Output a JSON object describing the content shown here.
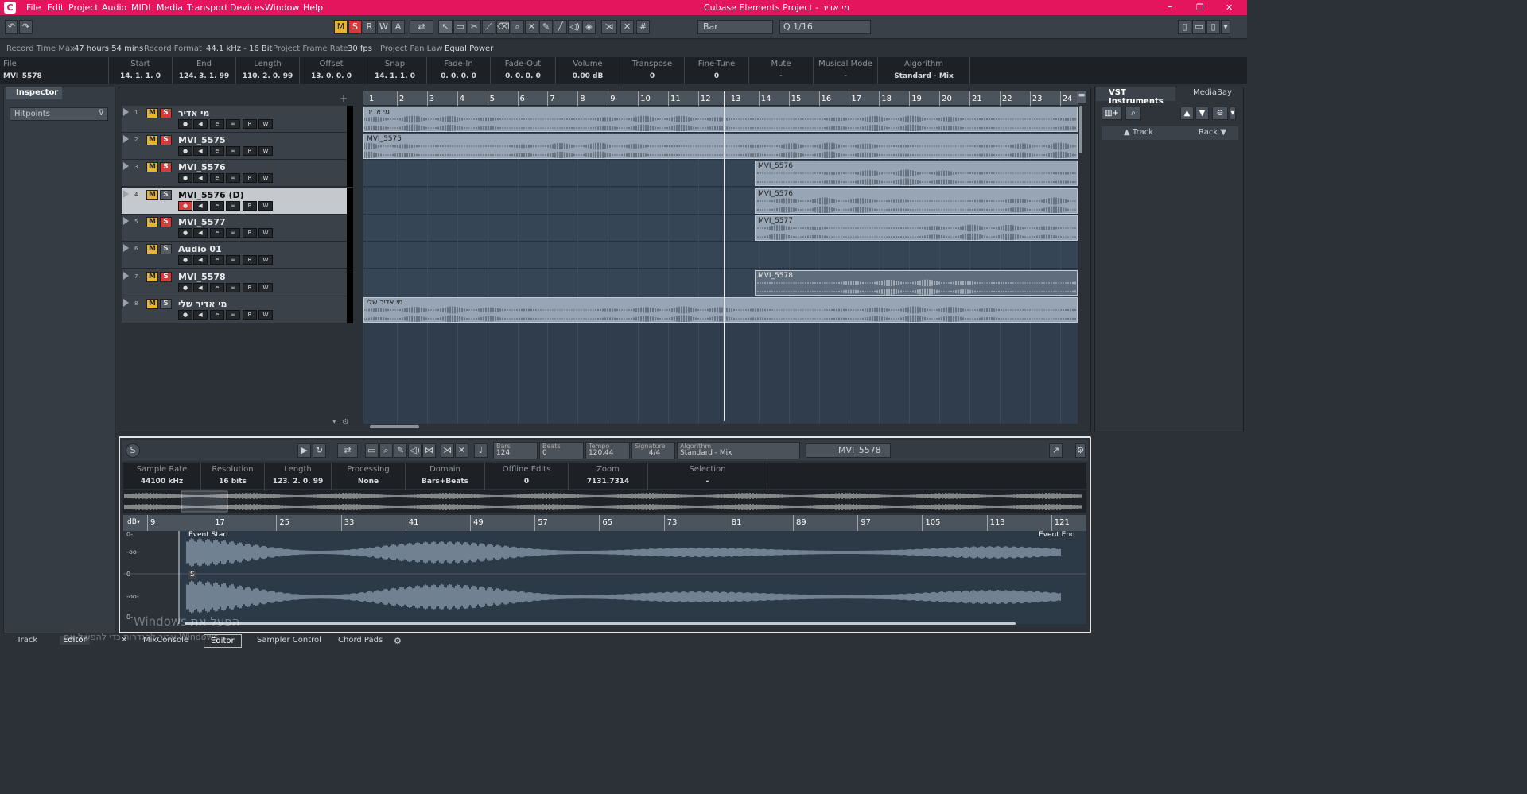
{
  "titlebar": {
    "logo": "C",
    "menus": [
      "File",
      "Edit",
      "Project",
      "Audio",
      "MIDI",
      "Media",
      "Transport",
      "Devices",
      "Window",
      "Help"
    ],
    "title": "Cubase Elements Project - מי אדיר",
    "minimize": "–",
    "restore": "❐",
    "close": "✕"
  },
  "toolbar": {
    "undo": "↶",
    "redo": "↷",
    "m": "M",
    "s": "S",
    "r": "R",
    "w": "W",
    "a": "A",
    "grid_type": "Bar",
    "quantize": "1/16",
    "quantize_prefix": "Q"
  },
  "project_info": {
    "record_time_max_label": "Record Time Max",
    "record_time_max": "47 hours 54 mins",
    "record_format_label": "Record Format",
    "record_format": "44.1 kHz - 16 Bit",
    "frame_rate_label": "Project Frame Rate",
    "frame_rate": "30 fps",
    "pan_law_label": "Project Pan Law",
    "pan_law": "Equal Power"
  },
  "infoline": {
    "file_label": "File",
    "file": "MVI_5578",
    "cols": [
      {
        "h": "Start",
        "v": "14. 1. 1.   0"
      },
      {
        "h": "End",
        "v": "124. 3. 1. 99"
      },
      {
        "h": "Length",
        "v": "110. 2. 0. 99"
      },
      {
        "h": "Offset",
        "v": "13. 0. 0.   0"
      },
      {
        "h": "Snap",
        "v": "14. 1. 1.   0"
      },
      {
        "h": "Fade-In",
        "v": "0. 0. 0.   0"
      },
      {
        "h": "Fade-Out",
        "v": "0. 0. 0.   0"
      },
      {
        "h": "Volume",
        "v": "0.00         dB"
      },
      {
        "h": "Transpose",
        "v": "0"
      },
      {
        "h": "Fine-Tune",
        "v": "0"
      },
      {
        "h": "Mute",
        "v": "-"
      },
      {
        "h": "Musical Mode",
        "v": "-"
      },
      {
        "h": "Algorithm",
        "v": "Standard - Mix"
      }
    ]
  },
  "inspector": {
    "tab": "Inspector",
    "hitpoints": "Hitpoints"
  },
  "tracks": [
    {
      "num": "1",
      "name": "מי אדיר",
      "solo": true,
      "selected": false
    },
    {
      "num": "2",
      "name": "MVI_5575",
      "solo": true,
      "selected": false
    },
    {
      "num": "3",
      "name": "MVI_5576",
      "solo": true,
      "selected": false
    },
    {
      "num": "4",
      "name": "MVI_5576 (D)",
      "solo": false,
      "selected": true
    },
    {
      "num": "5",
      "name": "MVI_5577",
      "solo": true,
      "selected": false
    },
    {
      "num": "6",
      "name": "Audio 01",
      "solo": false,
      "selected": false
    },
    {
      "num": "7",
      "name": "MVI_5578",
      "solo": true,
      "selected": false
    },
    {
      "num": "8",
      "name": "מי אדיר שלי",
      "solo": false,
      "selected": false
    }
  ],
  "track_buttons": {
    "m": "M",
    "s": "S",
    "r": "R",
    "w": "W",
    "rec": "●",
    "mon": "◀",
    "edit": "e",
    "link": "∞"
  },
  "ruler_numbers": [
    "1",
    "2",
    "3",
    "4",
    "5",
    "6",
    "7",
    "8",
    "9",
    "10",
    "11",
    "12",
    "13",
    "14",
    "15",
    "16",
    "17",
    "18",
    "19",
    "20",
    "21",
    "22",
    "23",
    "24"
  ],
  "events": [
    {
      "label": "מי אדיר",
      "dark": false
    },
    {
      "label": "MVI_5575",
      "dark": false
    },
    {
      "label": "MVI_5576",
      "dark": false
    },
    {
      "label": "MVI_5576",
      "dark": false
    },
    {
      "label": "MVI_5577",
      "dark": false
    },
    {
      "label": "MVI_5578",
      "dark": true
    },
    {
      "label": "מי אדיר שלי",
      "dark": false
    }
  ],
  "rightzone": {
    "tab_vst": "VST Instruments",
    "tab_mediabay": "MediaBay",
    "track": "▲ Track",
    "rack": "Rack ▼"
  },
  "editor": {
    "bars_label": "Bars",
    "bars": "124",
    "beats_label": "Beats",
    "beats": "0",
    "tempo_label": "Tempo",
    "tempo": "120.44",
    "signature_label": "Signature",
    "signature": "4/4",
    "algorithm_label": "Algorithm",
    "algorithm": "Standard - Mix",
    "clip_name": "MVI_5578",
    "info": [
      {
        "h": "Sample Rate",
        "v": "44100          kHz"
      },
      {
        "h": "Resolution",
        "v": "16           bits"
      },
      {
        "h": "Length",
        "v": "123. 2. 0. 99"
      },
      {
        "h": "Processing",
        "v": "None"
      },
      {
        "h": "Domain",
        "v": "Bars+Beats"
      },
      {
        "h": "Offline Edits",
        "v": "0"
      },
      {
        "h": "Zoom",
        "v": "7131.7314"
      },
      {
        "h": "Selection",
        "v": "-"
      }
    ],
    "ruler_unit": "dB",
    "ruler": [
      "9",
      "17",
      "25",
      "33",
      "41",
      "49",
      "57",
      "65",
      "73",
      "81",
      "89",
      "97",
      "105",
      "113",
      "121"
    ],
    "event_start": "Event Start",
    "event_end": "Event End",
    "s_marker": "S",
    "db_ticks": [
      "0-",
      "-oo-",
      "0",
      "-oo-",
      "0-"
    ]
  },
  "bottom_tabs": [
    "Track",
    "Editor",
    "MixConsole",
    "Editor",
    "Sampler Control",
    "Chord Pads"
  ],
  "watermark": {
    "line1": "Windows הפעל את",
    "line2": "עבור להגדרות כדי להפעיל את Windows"
  },
  "colors": {
    "brand": "#e4155c",
    "mute": "#e6b533",
    "solo": "#d63b3b",
    "event": "#97a5b4",
    "lane": "#364555"
  }
}
